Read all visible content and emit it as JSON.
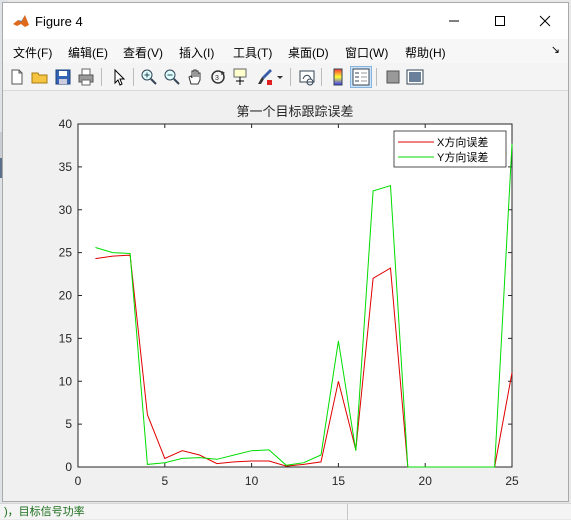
{
  "window": {
    "title": "Figure 4"
  },
  "menu": [
    "文件(F)",
    "编辑(E)",
    "查看(V)",
    "插入(I)",
    "工具(T)",
    "桌面(D)",
    "窗口(W)",
    "帮助(H)"
  ],
  "menu_overflow": "↘",
  "toolbar": [
    {
      "name": "new-figure-icon"
    },
    {
      "name": "open-file-icon"
    },
    {
      "name": "save-icon"
    },
    {
      "name": "print-icon"
    },
    {
      "name": "select-arrow-icon"
    },
    {
      "name": "zoom-in-icon"
    },
    {
      "name": "zoom-out-icon"
    },
    {
      "name": "pan-hand-icon"
    },
    {
      "name": "rotate-3d-icon"
    },
    {
      "name": "data-cursor-icon"
    },
    {
      "name": "brush-icon"
    },
    {
      "name": "brush-dropdown-icon"
    },
    {
      "name": "link-plot-icon"
    },
    {
      "name": "colorbar-icon"
    },
    {
      "name": "legend-icon"
    },
    {
      "name": "hide-plot-tools-icon"
    },
    {
      "name": "show-plot-tools-icon"
    }
  ],
  "background_text": ")，目标信号功率",
  "chart_data": {
    "type": "line",
    "title": "第一个目标跟踪误差",
    "xlabel": "",
    "ylabel": "",
    "xlim": [
      0,
      25
    ],
    "ylim": [
      0,
      40
    ],
    "xticks": [
      0,
      5,
      10,
      15,
      20,
      25
    ],
    "yticks": [
      0,
      5,
      10,
      15,
      20,
      25,
      30,
      35,
      40
    ],
    "grid": false,
    "legend_position": "top-right",
    "x": [
      1,
      2,
      3,
      4,
      5,
      6,
      7,
      8,
      9,
      10,
      11,
      12,
      13,
      14,
      15,
      16,
      17,
      18,
      19,
      20,
      21,
      22,
      23,
      24,
      25
    ],
    "series": [
      {
        "name": "X方向误差",
        "color": "#e00000",
        "values": [
          24.3,
          24.6,
          24.7,
          6.1,
          1.0,
          1.9,
          1.4,
          0.4,
          0.6,
          0.7,
          0.7,
          0.1,
          0.3,
          0.6,
          10.0,
          2.0,
          22.0,
          23.2,
          0,
          0,
          0,
          0,
          0,
          0,
          11.0
        ]
      },
      {
        "name": "Y方向误差",
        "color": "#00dd00",
        "values": [
          25.6,
          25.0,
          24.9,
          0.3,
          0.5,
          1.0,
          1.1,
          0.9,
          1.4,
          1.9,
          2.0,
          0.2,
          0.5,
          1.4,
          14.7,
          1.9,
          32.2,
          32.8,
          0,
          0,
          0,
          0,
          0,
          0,
          37.7
        ]
      }
    ]
  }
}
